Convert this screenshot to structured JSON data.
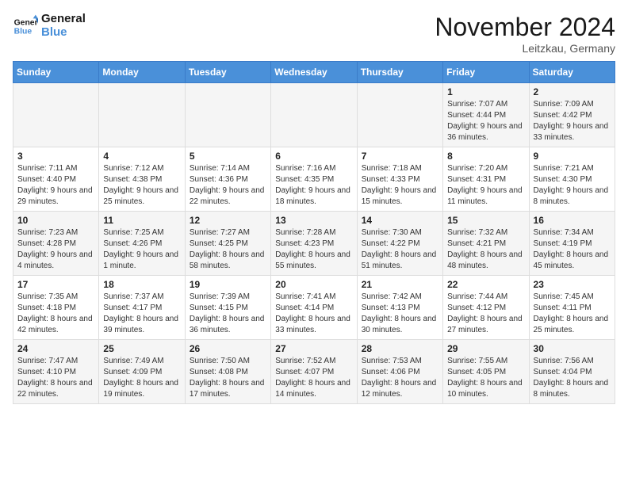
{
  "header": {
    "logo_general": "General",
    "logo_blue": "Blue",
    "month_title": "November 2024",
    "location": "Leitzkau, Germany"
  },
  "days_of_week": [
    "Sunday",
    "Monday",
    "Tuesday",
    "Wednesday",
    "Thursday",
    "Friday",
    "Saturday"
  ],
  "weeks": [
    [
      {
        "day": "",
        "info": ""
      },
      {
        "day": "",
        "info": ""
      },
      {
        "day": "",
        "info": ""
      },
      {
        "day": "",
        "info": ""
      },
      {
        "day": "",
        "info": ""
      },
      {
        "day": "1",
        "info": "Sunrise: 7:07 AM\nSunset: 4:44 PM\nDaylight: 9 hours\nand 36 minutes."
      },
      {
        "day": "2",
        "info": "Sunrise: 7:09 AM\nSunset: 4:42 PM\nDaylight: 9 hours\nand 33 minutes."
      }
    ],
    [
      {
        "day": "3",
        "info": "Sunrise: 7:11 AM\nSunset: 4:40 PM\nDaylight: 9 hours\nand 29 minutes."
      },
      {
        "day": "4",
        "info": "Sunrise: 7:12 AM\nSunset: 4:38 PM\nDaylight: 9 hours\nand 25 minutes."
      },
      {
        "day": "5",
        "info": "Sunrise: 7:14 AM\nSunset: 4:36 PM\nDaylight: 9 hours\nand 22 minutes."
      },
      {
        "day": "6",
        "info": "Sunrise: 7:16 AM\nSunset: 4:35 PM\nDaylight: 9 hours\nand 18 minutes."
      },
      {
        "day": "7",
        "info": "Sunrise: 7:18 AM\nSunset: 4:33 PM\nDaylight: 9 hours\nand 15 minutes."
      },
      {
        "day": "8",
        "info": "Sunrise: 7:20 AM\nSunset: 4:31 PM\nDaylight: 9 hours\nand 11 minutes."
      },
      {
        "day": "9",
        "info": "Sunrise: 7:21 AM\nSunset: 4:30 PM\nDaylight: 9 hours\nand 8 minutes."
      }
    ],
    [
      {
        "day": "10",
        "info": "Sunrise: 7:23 AM\nSunset: 4:28 PM\nDaylight: 9 hours\nand 4 minutes."
      },
      {
        "day": "11",
        "info": "Sunrise: 7:25 AM\nSunset: 4:26 PM\nDaylight: 9 hours\nand 1 minute."
      },
      {
        "day": "12",
        "info": "Sunrise: 7:27 AM\nSunset: 4:25 PM\nDaylight: 8 hours\nand 58 minutes."
      },
      {
        "day": "13",
        "info": "Sunrise: 7:28 AM\nSunset: 4:23 PM\nDaylight: 8 hours\nand 55 minutes."
      },
      {
        "day": "14",
        "info": "Sunrise: 7:30 AM\nSunset: 4:22 PM\nDaylight: 8 hours\nand 51 minutes."
      },
      {
        "day": "15",
        "info": "Sunrise: 7:32 AM\nSunset: 4:21 PM\nDaylight: 8 hours\nand 48 minutes."
      },
      {
        "day": "16",
        "info": "Sunrise: 7:34 AM\nSunset: 4:19 PM\nDaylight: 8 hours\nand 45 minutes."
      }
    ],
    [
      {
        "day": "17",
        "info": "Sunrise: 7:35 AM\nSunset: 4:18 PM\nDaylight: 8 hours\nand 42 minutes."
      },
      {
        "day": "18",
        "info": "Sunrise: 7:37 AM\nSunset: 4:17 PM\nDaylight: 8 hours\nand 39 minutes."
      },
      {
        "day": "19",
        "info": "Sunrise: 7:39 AM\nSunset: 4:15 PM\nDaylight: 8 hours\nand 36 minutes."
      },
      {
        "day": "20",
        "info": "Sunrise: 7:41 AM\nSunset: 4:14 PM\nDaylight: 8 hours\nand 33 minutes."
      },
      {
        "day": "21",
        "info": "Sunrise: 7:42 AM\nSunset: 4:13 PM\nDaylight: 8 hours\nand 30 minutes."
      },
      {
        "day": "22",
        "info": "Sunrise: 7:44 AM\nSunset: 4:12 PM\nDaylight: 8 hours\nand 27 minutes."
      },
      {
        "day": "23",
        "info": "Sunrise: 7:45 AM\nSunset: 4:11 PM\nDaylight: 8 hours\nand 25 minutes."
      }
    ],
    [
      {
        "day": "24",
        "info": "Sunrise: 7:47 AM\nSunset: 4:10 PM\nDaylight: 8 hours\nand 22 minutes."
      },
      {
        "day": "25",
        "info": "Sunrise: 7:49 AM\nSunset: 4:09 PM\nDaylight: 8 hours\nand 19 minutes."
      },
      {
        "day": "26",
        "info": "Sunrise: 7:50 AM\nSunset: 4:08 PM\nDaylight: 8 hours\nand 17 minutes."
      },
      {
        "day": "27",
        "info": "Sunrise: 7:52 AM\nSunset: 4:07 PM\nDaylight: 8 hours\nand 14 minutes."
      },
      {
        "day": "28",
        "info": "Sunrise: 7:53 AM\nSunset: 4:06 PM\nDaylight: 8 hours\nand 12 minutes."
      },
      {
        "day": "29",
        "info": "Sunrise: 7:55 AM\nSunset: 4:05 PM\nDaylight: 8 hours\nand 10 minutes."
      },
      {
        "day": "30",
        "info": "Sunrise: 7:56 AM\nSunset: 4:04 PM\nDaylight: 8 hours\nand 8 minutes."
      }
    ]
  ]
}
